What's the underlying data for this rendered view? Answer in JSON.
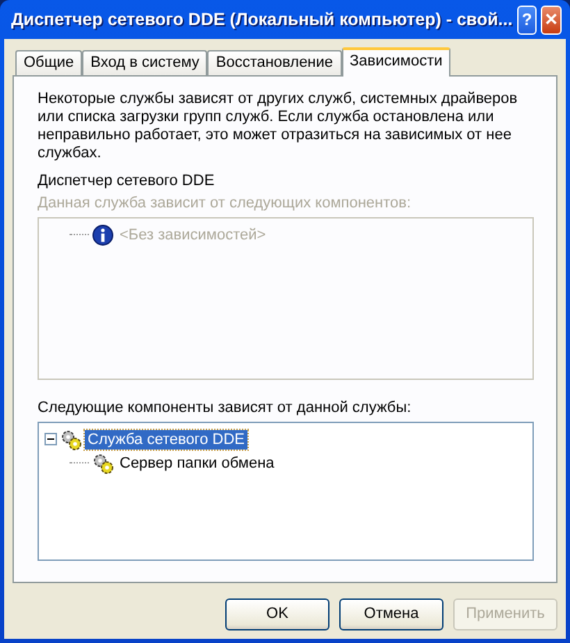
{
  "window": {
    "title": "Диспетчер сетевого DDE (Локальный компьютер) - свой...",
    "help_button": "?",
    "close_button": "✕"
  },
  "tabs": [
    {
      "label": "Общие",
      "selected": false
    },
    {
      "label": "Вход в систему",
      "selected": false
    },
    {
      "label": "Восстановление",
      "selected": false
    },
    {
      "label": "Зависимости",
      "selected": true
    }
  ],
  "description": "Некоторые службы зависят от других служб, системных драйверов или списка загрузки групп служб. Если служба остановлена или неправильно работает, это может отразиться на зависимых от нее службах.",
  "service_name": "Диспетчер сетевого DDE",
  "depends_on": {
    "label": "Данная служба зависит от следующих компонентов:",
    "disabled": true,
    "items": [
      {
        "label": "<Без зависимостей>",
        "kind": "info",
        "selected": false
      }
    ]
  },
  "dependents": {
    "label": "Следующие компоненты зависят от данной службы:",
    "items": [
      {
        "label": "Служба сетевого DDE",
        "kind": "service",
        "selected": true,
        "expanded": true,
        "children": [
          {
            "label": "Сервер папки обмена",
            "kind": "service",
            "selected": false
          }
        ]
      }
    ]
  },
  "buttons": [
    {
      "label": "OK",
      "disabled": false
    },
    {
      "label": "Отмена",
      "disabled": false
    },
    {
      "label": "Применить",
      "disabled": true
    }
  ]
}
